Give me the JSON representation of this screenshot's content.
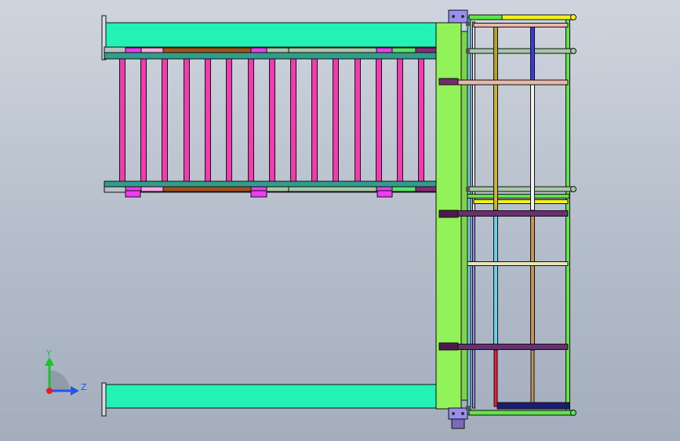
{
  "app": {
    "view": "CAD 3D viewport"
  },
  "triad": {
    "y_label": "Y",
    "z_label": "Z"
  },
  "colors": {
    "beam": "#22f2b4",
    "column": "#92f25a",
    "rung": "#f33ab1",
    "rail_teal": "#2f9e8c",
    "rail_brown": "#a55416",
    "rail_sage": "#a8c7a6",
    "rail_green": "#5de26a",
    "bracket": "#ee3cf2",
    "handrail_yellow": "#f2f21e",
    "handrail_green": "#62e34c",
    "post_white": "#f2f2ee",
    "post_blue": "#3a3ad8",
    "post_olive": "#b5a22c",
    "post_cyan": "#6ecfe8",
    "post_pink": "#e8b8a8",
    "cross_purple": "#6a2f6f",
    "post_red": "#e8203a",
    "post_tan": "#c69258",
    "mount_lilac": "#9a8ff0",
    "floor_navy": "#1b1b6f",
    "axis_y": "#18c230",
    "axis_z": "#2255e8",
    "origin": "#e02020"
  }
}
